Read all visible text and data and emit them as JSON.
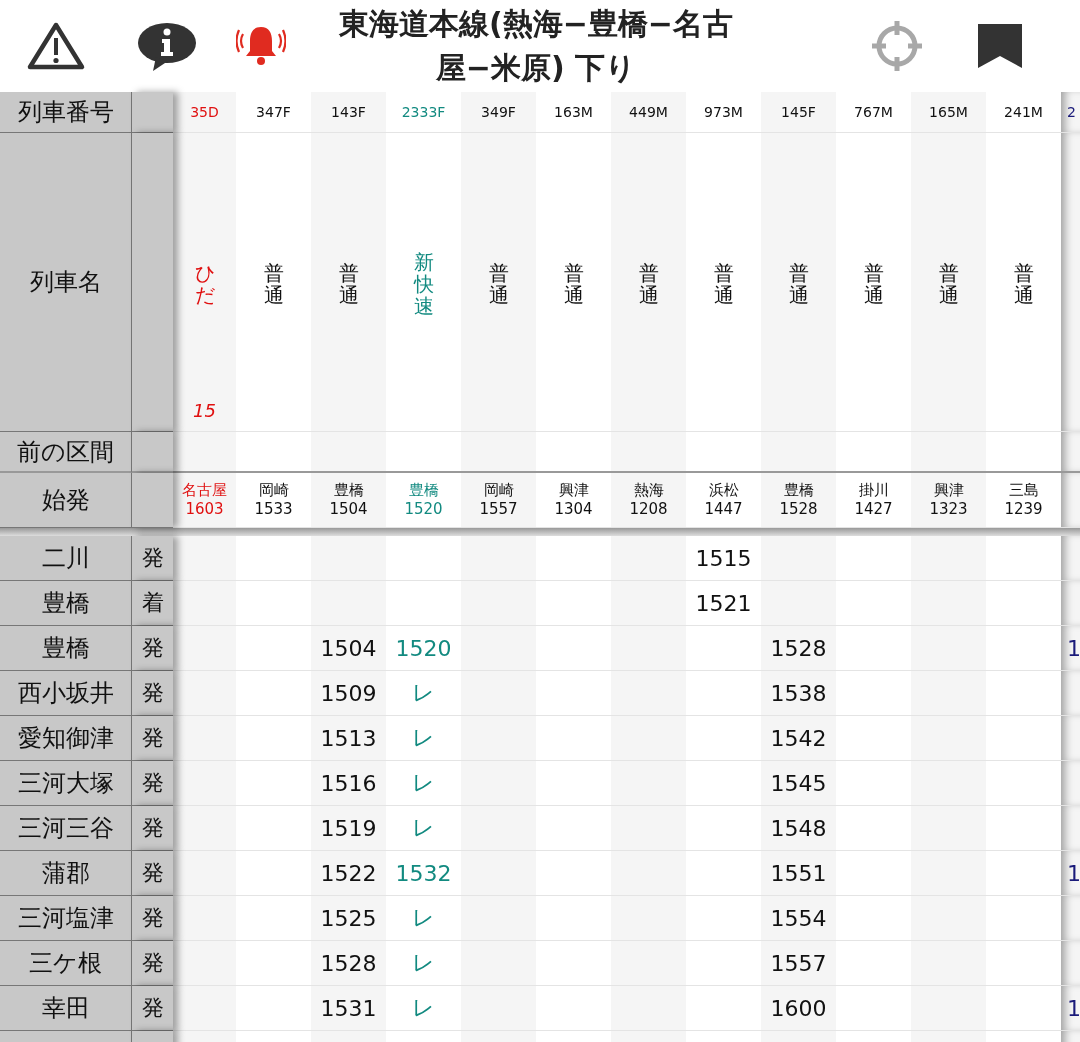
{
  "title": "東海道本線(熱海−豊橋−名古屋−米原) 下り",
  "row_labels": [
    "列車番号",
    "列車名",
    "前の区間",
    "始発"
  ],
  "trains": [
    {
      "kind": "limited",
      "number": "35D",
      "name": "ひだ",
      "note": "15",
      "origin": "名古屋",
      "origin_time": "1603"
    },
    {
      "kind": "local",
      "number": "347F",
      "name": "普通",
      "origin": "岡崎",
      "origin_time": "1533"
    },
    {
      "kind": "local",
      "number": "143F",
      "name": "普通",
      "origin": "豊橋",
      "origin_time": "1504"
    },
    {
      "kind": "rapid",
      "number": "2333F",
      "name": "新快速",
      "origin": "豊橋",
      "origin_time": "1520"
    },
    {
      "kind": "local",
      "number": "349F",
      "name": "普通",
      "origin": "岡崎",
      "origin_time": "1557"
    },
    {
      "kind": "local",
      "number": "163M",
      "name": "普通",
      "origin": "興津",
      "origin_time": "1304"
    },
    {
      "kind": "local",
      "number": "449M",
      "name": "普通",
      "origin": "熱海",
      "origin_time": "1208"
    },
    {
      "kind": "local",
      "number": "973M",
      "name": "普通",
      "origin": "浜松",
      "origin_time": "1447"
    },
    {
      "kind": "local",
      "number": "145F",
      "name": "普通",
      "origin": "豊橋",
      "origin_time": "1528"
    },
    {
      "kind": "local",
      "number": "767M",
      "name": "普通",
      "origin": "掛川",
      "origin_time": "1427"
    },
    {
      "kind": "local",
      "number": "165M",
      "name": "普通",
      "origin": "興津",
      "origin_time": "1323"
    },
    {
      "kind": "local",
      "number": "241M",
      "name": "普通",
      "origin": "三島",
      "origin_time": "1239"
    },
    {
      "kind": "special",
      "number": "2"
    }
  ],
  "stations": [
    {
      "name": "二川",
      "type": "発",
      "times": {
        "7": "1515"
      }
    },
    {
      "name": "豊橋",
      "type": "着",
      "times": {
        "7": "1521"
      }
    },
    {
      "name": "豊橋",
      "type": "発",
      "times": {
        "2": "1504",
        "3": "1520",
        "8": "1528",
        "12": "1"
      }
    },
    {
      "name": "西小坂井",
      "type": "発",
      "times": {
        "2": "1509",
        "3": "レ",
        "8": "1538"
      }
    },
    {
      "name": "愛知御津",
      "type": "発",
      "times": {
        "2": "1513",
        "3": "レ",
        "8": "1542"
      }
    },
    {
      "name": "三河大塚",
      "type": "発",
      "times": {
        "2": "1516",
        "3": "レ",
        "8": "1545"
      }
    },
    {
      "name": "三河三谷",
      "type": "発",
      "times": {
        "2": "1519",
        "3": "レ",
        "8": "1548"
      }
    },
    {
      "name": "蒲郡",
      "type": "発",
      "times": {
        "2": "1522",
        "3": "1532",
        "8": "1551",
        "12": "1"
      }
    },
    {
      "name": "三河塩津",
      "type": "発",
      "times": {
        "2": "1525",
        "3": "レ",
        "8": "1554"
      }
    },
    {
      "name": "三ケ根",
      "type": "発",
      "times": {
        "2": "1528",
        "3": "レ",
        "8": "1557"
      }
    },
    {
      "name": "幸田",
      "type": "発",
      "times": {
        "2": "1531",
        "3": "レ",
        "8": "1600",
        "12": "1"
      }
    }
  ]
}
